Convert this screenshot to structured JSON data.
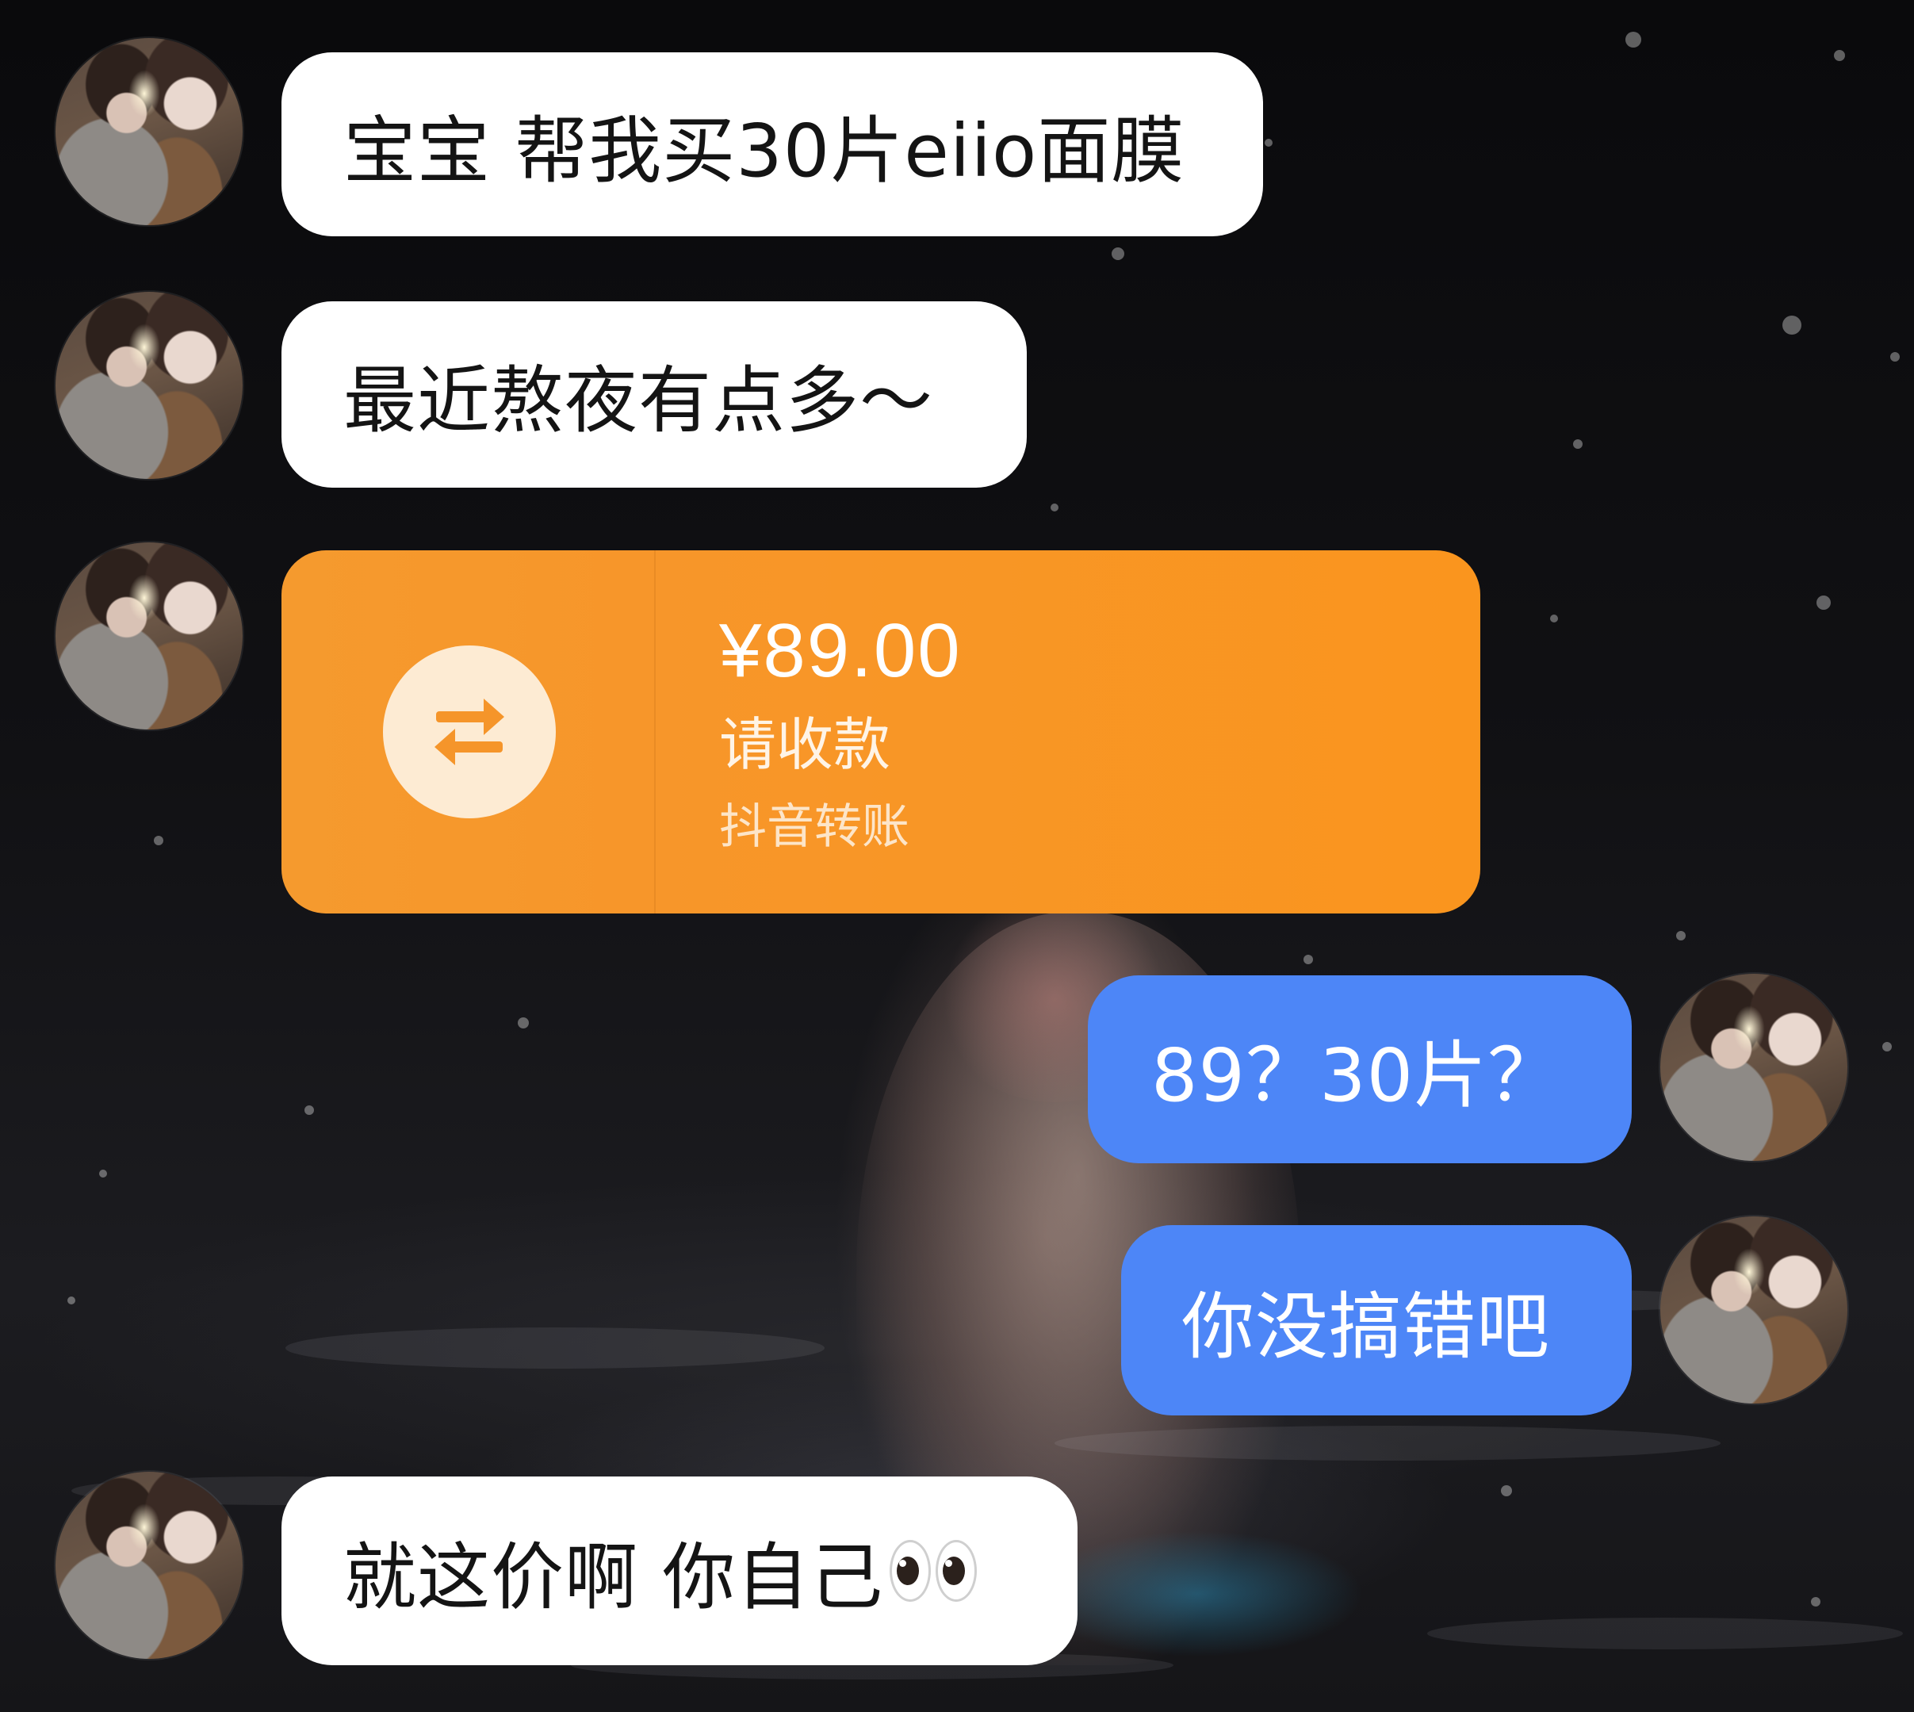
{
  "messages": [
    {
      "side": "incoming",
      "text": "宝宝 帮我买30片eiio面膜"
    },
    {
      "side": "incoming",
      "text": "最近熬夜有点多～"
    },
    {
      "side": "incoming",
      "type": "transfer",
      "amount": "¥89.00",
      "label": "请收款",
      "source": "抖音转账",
      "icon": "transfer-arrows-icon",
      "color": "#F7962A"
    },
    {
      "side": "outgoing",
      "text": "89？30片？"
    },
    {
      "side": "outgoing",
      "text": "你没搞错吧"
    },
    {
      "side": "incoming",
      "text": "就这价啊 你自己",
      "emoji": "eyes-emoji"
    }
  ],
  "colors": {
    "incoming_bubble": "#FFFFFF",
    "outgoing_bubble": "#4D86F7",
    "transfer_card": "#F7962A",
    "background": "#0B0B0D"
  }
}
